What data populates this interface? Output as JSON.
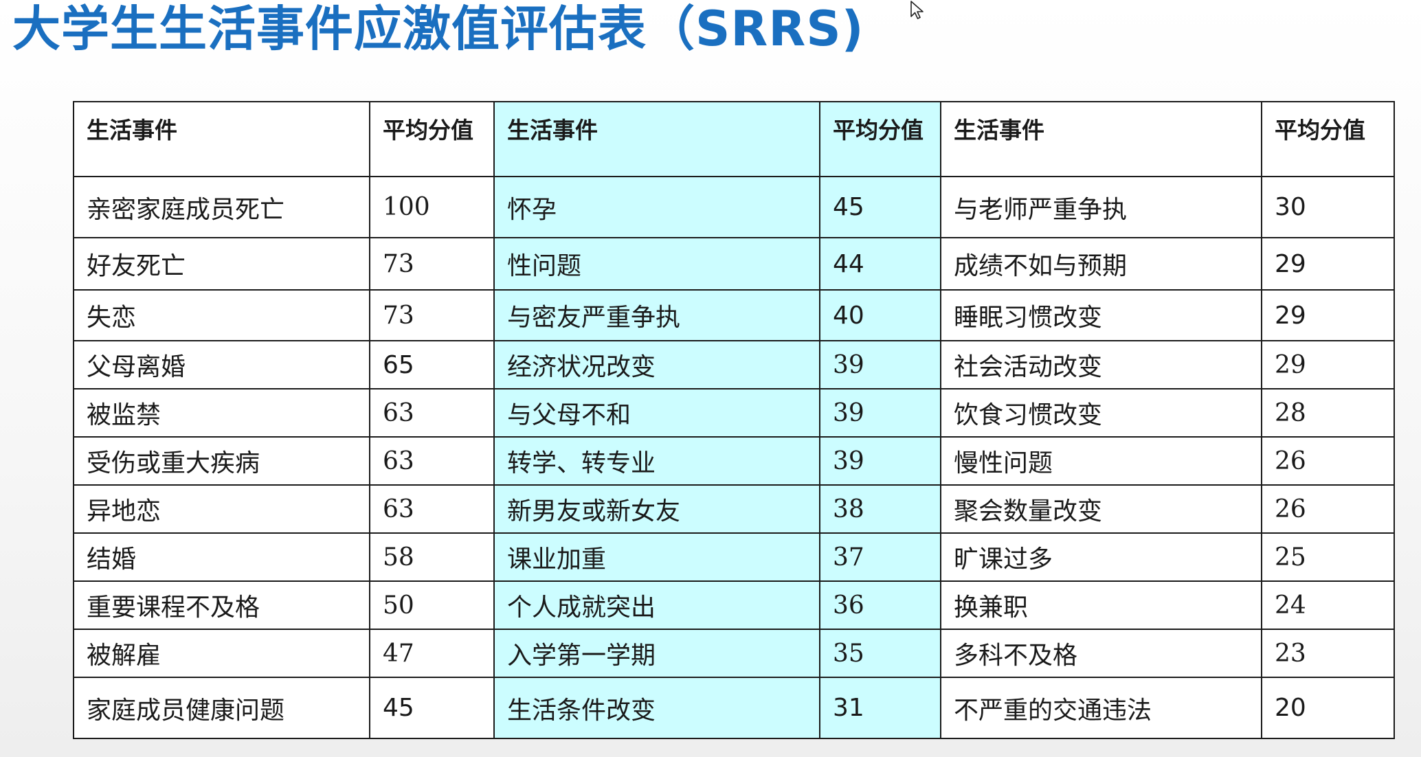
{
  "slide": {
    "title": "大学生生活事件应激值评估表（SRRS)"
  },
  "table": {
    "headers": [
      "生活事件",
      "平均分值",
      "生活事件",
      "平均分值",
      "生活事件",
      "平均分值"
    ],
    "rows": [
      [
        {
          "text": "亲密家庭成员死亡",
          "sans": false
        },
        {
          "text": "100",
          "sans": false
        },
        {
          "text": "怀孕",
          "sans": false
        },
        {
          "text": "45",
          "sans": true
        },
        {
          "text": "与老师严重争执",
          "sans": false
        },
        {
          "text": "30",
          "sans": true
        }
      ],
      [
        {
          "text": "好友死亡",
          "sans": false
        },
        {
          "text": "73",
          "sans": false
        },
        {
          "text": "性问题",
          "sans": false
        },
        {
          "text": "44",
          "sans": true
        },
        {
          "text": "成绩不如与预期",
          "sans": false
        },
        {
          "text": "29",
          "sans": true
        }
      ],
      [
        {
          "text": "失恋",
          "sans": false
        },
        {
          "text": "73",
          "sans": false
        },
        {
          "text": "与密友严重争执",
          "sans": false
        },
        {
          "text": "40",
          "sans": true
        },
        {
          "text": "睡眠习惯改变",
          "sans": false
        },
        {
          "text": "29",
          "sans": true
        }
      ],
      [
        {
          "text": "父母离婚",
          "sans": false
        },
        {
          "text": "65",
          "sans": true
        },
        {
          "text": "经济状况改变",
          "sans": false
        },
        {
          "text": "39",
          "sans": false
        },
        {
          "text": "社会活动改变",
          "sans": false
        },
        {
          "text": "29",
          "sans": false
        }
      ],
      [
        {
          "text": "被监禁",
          "sans": false
        },
        {
          "text": "63",
          "sans": false
        },
        {
          "text": "与父母不和",
          "sans": false
        },
        {
          "text": "39",
          "sans": false
        },
        {
          "text": "饮食习惯改变",
          "sans": false
        },
        {
          "text": "28",
          "sans": false
        }
      ],
      [
        {
          "text": "受伤或重大疾病",
          "sans": false
        },
        {
          "text": "63",
          "sans": false
        },
        {
          "text": "转学、转专业",
          "sans": false
        },
        {
          "text": "39",
          "sans": false
        },
        {
          "text": "慢性问题",
          "sans": false
        },
        {
          "text": "26",
          "sans": false
        }
      ],
      [
        {
          "text": "异地恋",
          "sans": false
        },
        {
          "text": "63",
          "sans": false
        },
        {
          "text": "新男友或新女友",
          "sans": false
        },
        {
          "text": "38",
          "sans": false
        },
        {
          "text": "聚会数量改变",
          "sans": false
        },
        {
          "text": "26",
          "sans": false
        }
      ],
      [
        {
          "text": "结婚",
          "sans": false
        },
        {
          "text": "58",
          "sans": false
        },
        {
          "text": "课业加重",
          "sans": false
        },
        {
          "text": "37",
          "sans": false
        },
        {
          "text": "旷课过多",
          "sans": false
        },
        {
          "text": "25",
          "sans": false
        }
      ],
      [
        {
          "text": "重要课程不及格",
          "sans": false
        },
        {
          "text": "50",
          "sans": false
        },
        {
          "text": "个人成就突出",
          "sans": false
        },
        {
          "text": "36",
          "sans": false
        },
        {
          "text": "换兼职",
          "sans": false
        },
        {
          "text": "24",
          "sans": false
        }
      ],
      [
        {
          "text": "被解雇",
          "sans": false
        },
        {
          "text": "47",
          "sans": false
        },
        {
          "text": "入学第一学期",
          "sans": false
        },
        {
          "text": "35",
          "sans": false
        },
        {
          "text": "多科不及格",
          "sans": false
        },
        {
          "text": "23",
          "sans": false
        }
      ],
      [
        {
          "text": "家庭成员健康问题",
          "sans": false
        },
        {
          "text": "45",
          "sans": true
        },
        {
          "text": "生活条件改变",
          "sans": false
        },
        {
          "text": "31",
          "sans": true
        },
        {
          "text": "不严重的交通违法",
          "sans": false
        },
        {
          "text": "20",
          "sans": true
        }
      ]
    ]
  },
  "colors": {
    "title": "#1a6fc0",
    "highlight_columns": "#ccfdff",
    "border": "#1a1a1a"
  },
  "icons": {
    "cursor": "mouse-pointer-icon"
  }
}
